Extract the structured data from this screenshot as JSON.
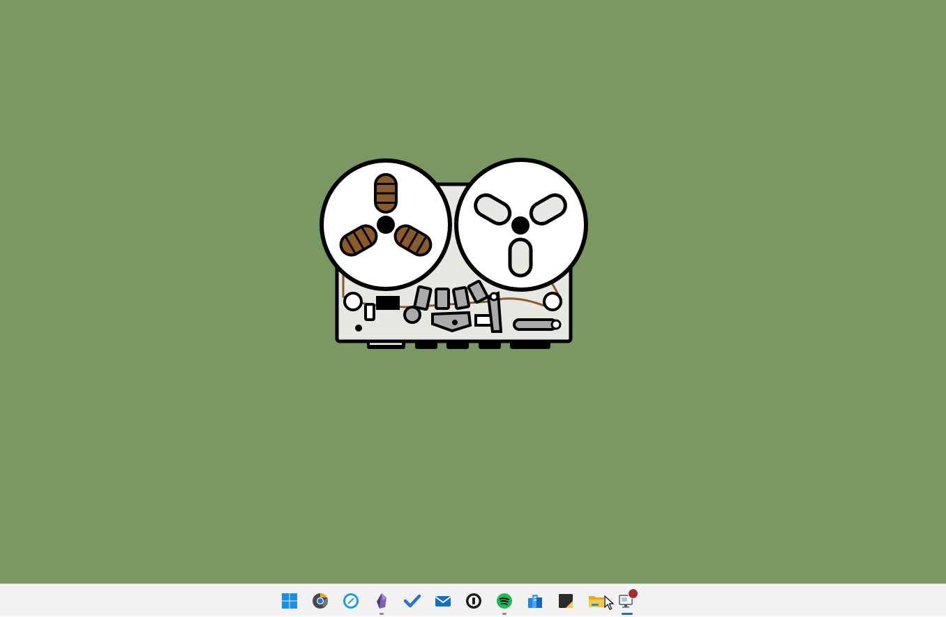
{
  "desktop": {
    "background_color": "#7a9862",
    "wallpaper": {
      "subject": "reel-to-reel-tape-recorder",
      "body_color": "#e8e8e2",
      "tape_color": "#8b5a2b",
      "reel_color": "#ffffff",
      "outline_color": "#000000"
    }
  },
  "taskbar": {
    "background_color": "#f2f2f2",
    "indicator_color": "#8a8a8a",
    "active_indicator_color": "#1f6fbf",
    "items": [
      {
        "icon": "windows-start-icon",
        "running": false
      },
      {
        "icon": "chrome-dev-icon",
        "running": false
      },
      {
        "icon": "compass-browser-icon",
        "running": false
      },
      {
        "icon": "obsidian-icon",
        "running": true
      },
      {
        "icon": "todo-check-icon",
        "running": false
      },
      {
        "icon": "mail-icon",
        "running": false
      },
      {
        "icon": "password-manager-icon",
        "running": false
      },
      {
        "icon": "spotify-icon",
        "running": true
      },
      {
        "icon": "database-icon",
        "running": false
      },
      {
        "icon": "sticky-notes-icon",
        "running": false
      },
      {
        "icon": "file-explorer-icon",
        "running": false
      },
      {
        "icon": "remote-desktop-icon",
        "running": true,
        "active": true,
        "notification": true
      }
    ]
  }
}
